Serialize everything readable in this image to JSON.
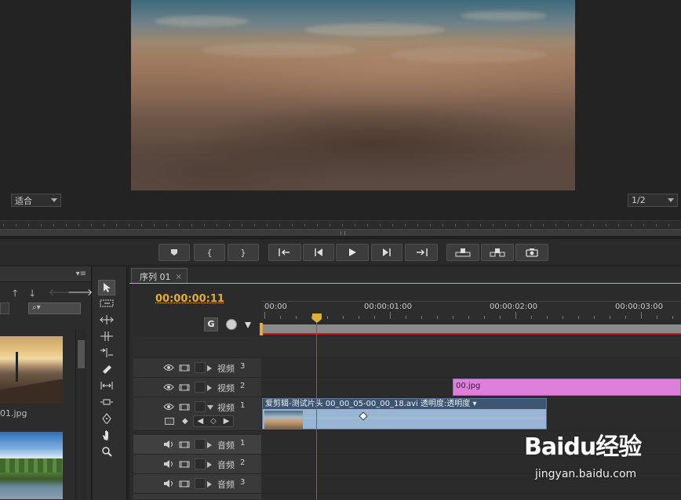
{
  "monitor": {
    "fit_select": "适合",
    "resolution_select": "1/2"
  },
  "transport": {
    "buttons": [
      {
        "icon": "marker-icon"
      },
      {
        "icon": "mark-in-icon",
        "glyph": "{"
      },
      {
        "icon": "mark-out-icon",
        "glyph": "}"
      },
      {
        "icon": "go-to-in-icon"
      },
      {
        "icon": "step-back-icon"
      },
      {
        "icon": "play-icon"
      },
      {
        "icon": "step-forward-icon"
      },
      {
        "icon": "go-to-out-icon"
      },
      {
        "icon": "lift-icon"
      },
      {
        "icon": "extract-icon"
      },
      {
        "icon": "export-frame-icon"
      }
    ]
  },
  "project": {
    "items": [
      {
        "name": "01.jpg"
      }
    ]
  },
  "timeline": {
    "tab_label": "序列 01",
    "timecode": "00:00:00:11",
    "ruler_labels": [
      "00:00",
      "00:00:01:00",
      "00:00:02:00",
      "00:00:03:00"
    ],
    "tracks": [
      {
        "label": "视频",
        "number": "3",
        "kind": "video"
      },
      {
        "label": "视频",
        "number": "2",
        "kind": "video"
      },
      {
        "label": "视频",
        "number": "1",
        "kind": "video"
      },
      {
        "label": "音频",
        "number": "1",
        "kind": "audio"
      },
      {
        "label": "音频",
        "number": "2",
        "kind": "audio"
      },
      {
        "label": "音频",
        "number": "3",
        "kind": "audio"
      }
    ],
    "clips": {
      "jpg": "00.jpg",
      "avi": "爱剪辑-测试片头  00_00_05-00_00_18.avi  透明度:透明度 ▾"
    }
  },
  "watermark": {
    "logo": "Baidu经验",
    "url": "jingyan.baidu.com"
  },
  "colors": {
    "timecode": "#e2ad38",
    "playhead": "#d03a2a",
    "clip_jpg": "#df7fdc",
    "clip_avi": "#9ab5d4"
  }
}
